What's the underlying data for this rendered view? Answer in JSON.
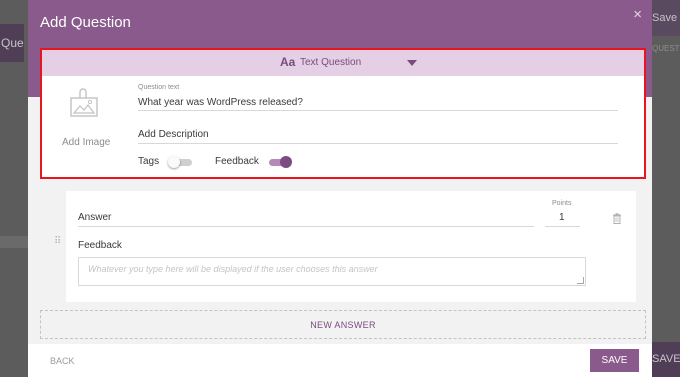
{
  "background": {
    "left_button": "Question",
    "right_button": "Save Quiz",
    "right_text": "QUESTIONS",
    "right_bottom_button": "SAVE"
  },
  "modal": {
    "title": "Add Question",
    "close_icon": "×"
  },
  "question": {
    "type_icon": "Aa",
    "type_label": "Text Question",
    "add_image_label": "Add Image",
    "question_text_label": "Question text",
    "question_text_value": "What year was WordPress released?",
    "description_placeholder": "Add Description",
    "tags_label": "Tags",
    "tags_enabled": false,
    "feedback_label": "Feedback",
    "feedback_enabled": true
  },
  "answer": {
    "answer_placeholder": "Answer",
    "points_label": "Points",
    "points_value": "1",
    "feedback_label": "Feedback",
    "feedback_placeholder": "Whatever you type here will be displayed if the user chooses this answer",
    "drag_handle": "⠿"
  },
  "new_answer_label": "NEW ANSWER",
  "footer": {
    "back_label": "BACK",
    "save_label": "SAVE"
  },
  "colors": {
    "accent": "#8a5a8c",
    "type_bar": "#e4cfe4",
    "highlight": "#e8141e"
  }
}
